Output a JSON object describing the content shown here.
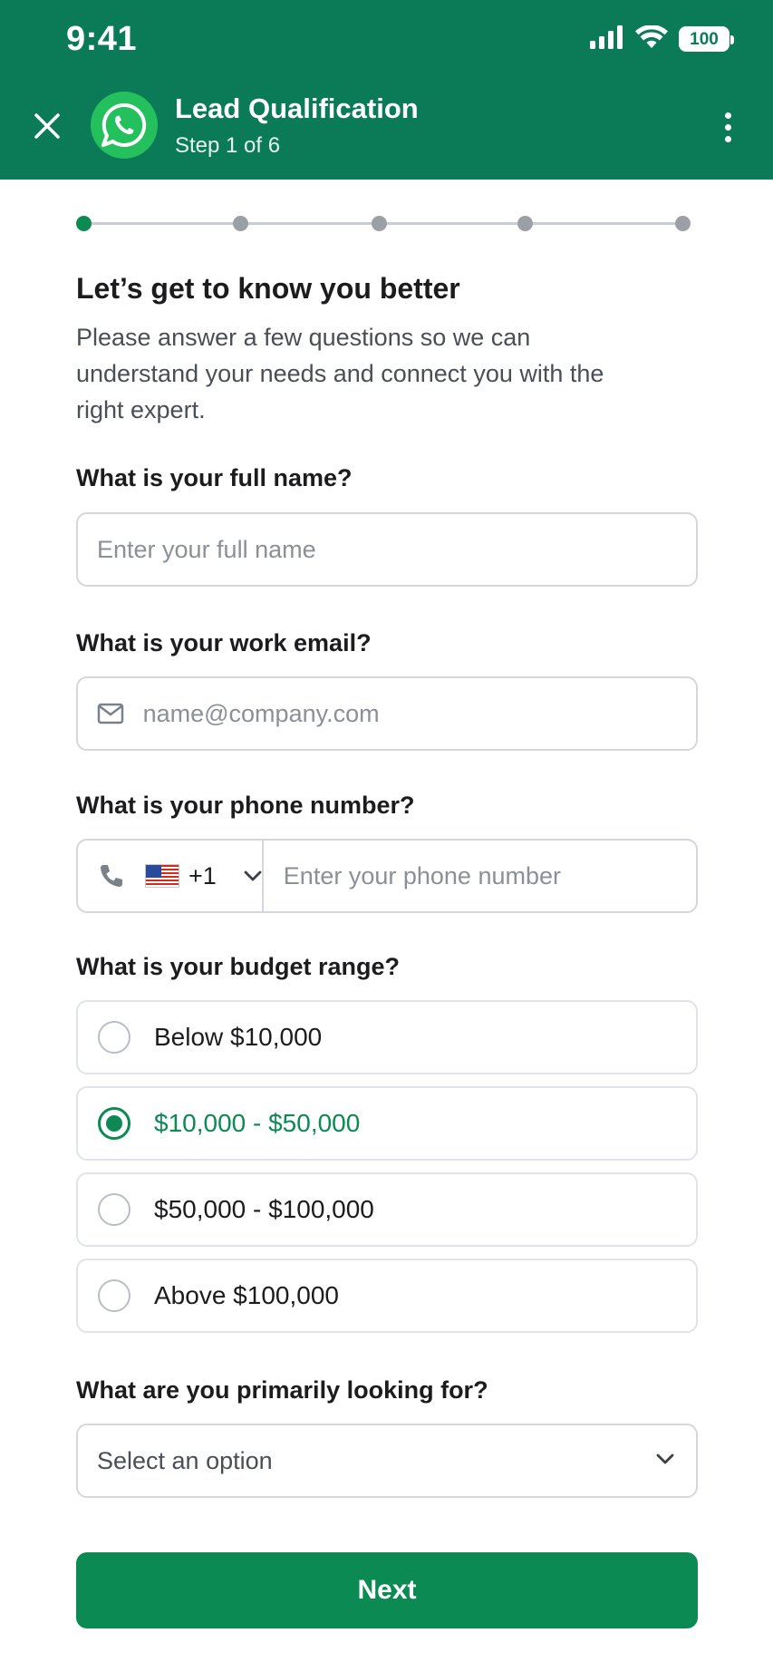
{
  "status_bar": {
    "time": "9:41",
    "battery": "100"
  },
  "header": {
    "title": "Lead Qualification",
    "subtitle": "Step 1 of 6",
    "close_icon": "close-icon",
    "avatar_icon": "whatsapp-icon",
    "menu_icon": "more-vertical-icon"
  },
  "progress": {
    "current_step": 1,
    "total_dots": 5
  },
  "intro": {
    "heading": "Let’s get to know you better",
    "description": "Please answer a few questions so we can understand your needs and connect you with the right expert."
  },
  "fields": {
    "name": {
      "label": "What is your full name?",
      "value": "",
      "placeholder": "Enter your full name"
    },
    "email": {
      "label": "What is your work email?",
      "value": "",
      "placeholder": "name@company.com",
      "icon": "mail-icon"
    },
    "phone": {
      "label": "What is your phone number?",
      "country_code": "+1",
      "flag": "us-flag-icon",
      "value": "",
      "placeholder": "Enter your phone number",
      "icon": "phone-icon"
    }
  },
  "budget": {
    "label": "What is your budget range?",
    "options": [
      {
        "label": "Below $10,000",
        "selected": false
      },
      {
        "label": "$10,000 - $50,000",
        "selected": true
      },
      {
        "label": "$50,000 - $100,000",
        "selected": false
      },
      {
        "label": "Above $100,000",
        "selected": false
      }
    ]
  },
  "looking_for": {
    "label": "What are you primarily looking for?",
    "value": "Select an option"
  },
  "actions": {
    "next_label": "Next"
  },
  "colors": {
    "header_bg": "#0b7a57",
    "accent": "#0b8a54",
    "whatsapp_green": "#25c05e"
  }
}
